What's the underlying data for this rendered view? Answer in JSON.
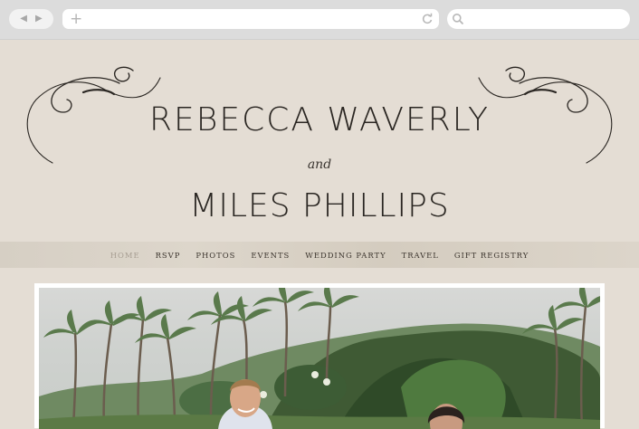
{
  "browser": {
    "back_icon": "back-arrow-icon",
    "forward_icon": "forward-arrow-icon",
    "back_glyph": "◀",
    "forward_glyph": "▶",
    "new_tab_glyph": "+",
    "address_value": "",
    "search_value": ""
  },
  "couple": {
    "name_one": "REBECCA WAVERLY",
    "connector": "and",
    "name_two": "MILES PHILLIPS"
  },
  "nav": {
    "items": [
      "HOME",
      "RSVP",
      "PHOTOS",
      "EVENTS",
      "WEDDING PARTY",
      "TRAVEL",
      "GIFT REGISTRY"
    ],
    "active": "HOME"
  },
  "colors": {
    "page_background": "#e4ddd4",
    "text": "#2a2622",
    "active_nav": "#a79e92"
  }
}
